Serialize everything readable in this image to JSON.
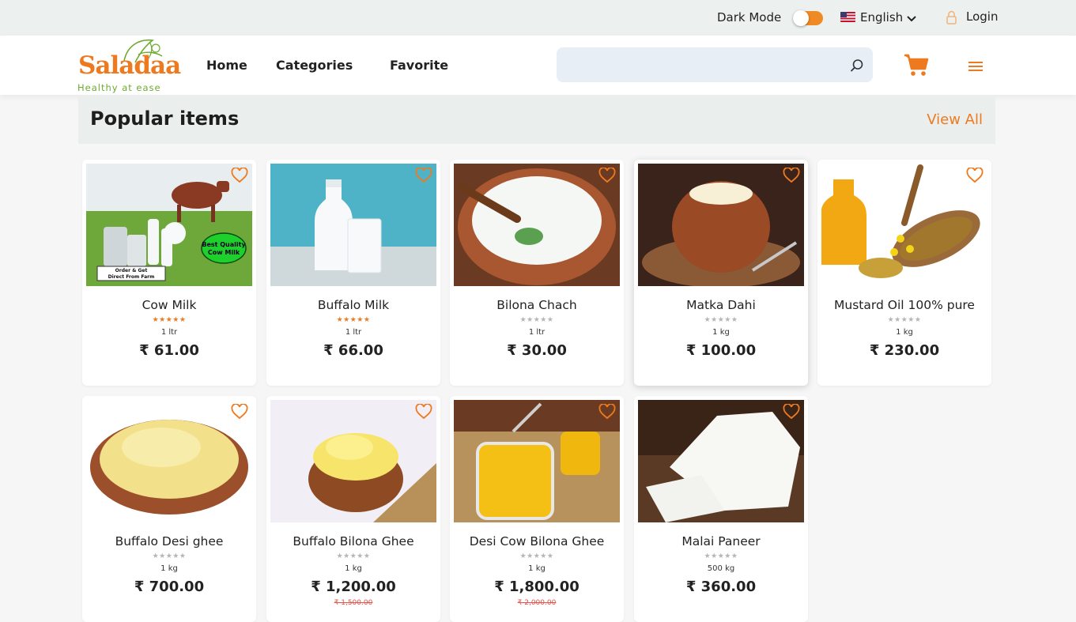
{
  "topbar": {
    "dark_mode_label": "Dark Mode",
    "language": "English",
    "login": "Login",
    "toggle_color": "#f08a24"
  },
  "header": {
    "logo_text": "Saladaa",
    "logo_tagline": "Healthy at ease",
    "nav": [
      "Home",
      "Categories",
      "Favorite"
    ],
    "search_placeholder": "",
    "icons": [
      "search-icon",
      "cart-icon",
      "menu-icon"
    ],
    "accent": "#ee7a20"
  },
  "section": {
    "title": "Popular items",
    "view_all": "View All"
  },
  "products": [
    {
      "name": "Cow Milk",
      "unit": "1 ltr",
      "price": "₹ 61.00",
      "stars": "★★★★★",
      "rated": true,
      "image": "cow-milk"
    },
    {
      "name": "Buffalo Milk",
      "unit": "1 ltr",
      "price": "₹ 66.00",
      "stars": "★★★★★",
      "rated": true,
      "image": "buffalo-milk"
    },
    {
      "name": "Bilona Chach",
      "unit": "1 ltr",
      "price": "₹ 30.00",
      "stars": "★★★★★",
      "rated": false,
      "image": "chach"
    },
    {
      "name": "Matka Dahi",
      "unit": "1 kg",
      "price": "₹ 100.00",
      "stars": "★★★★★",
      "rated": false,
      "image": "dahi"
    },
    {
      "name": "Mustard Oil 100% pure",
      "unit": "1 kg",
      "price": "₹ 230.00",
      "stars": "★★★★★",
      "rated": false,
      "image": "mustard-oil"
    },
    {
      "name": "Buffalo Desi ghee",
      "unit": "1 kg",
      "price": "₹ 700.00",
      "stars": "★★★★★",
      "rated": false,
      "image": "desi-ghee"
    },
    {
      "name": "Buffalo Bilona Ghee",
      "unit": "1 kg",
      "price": "₹ 1,200.00",
      "old_price": "₹ 1,500.00",
      "stars": "★★★★★",
      "rated": false,
      "image": "bilona-ghee"
    },
    {
      "name": "Desi Cow Bilona Ghee",
      "unit": "1 kg",
      "price": "₹ 1,800.00",
      "old_price": "₹ 2,000.00",
      "stars": "★★★★★",
      "rated": false,
      "image": "cow-ghee"
    },
    {
      "name": "Malai Paneer",
      "unit": "500 kg",
      "price": "₹ 360.00",
      "stars": "★★★★★",
      "rated": false,
      "image": "paneer"
    }
  ],
  "image_text": {
    "badge": "Best Quality Cow Milk",
    "sign": "Order & Get Direct From Farm"
  }
}
